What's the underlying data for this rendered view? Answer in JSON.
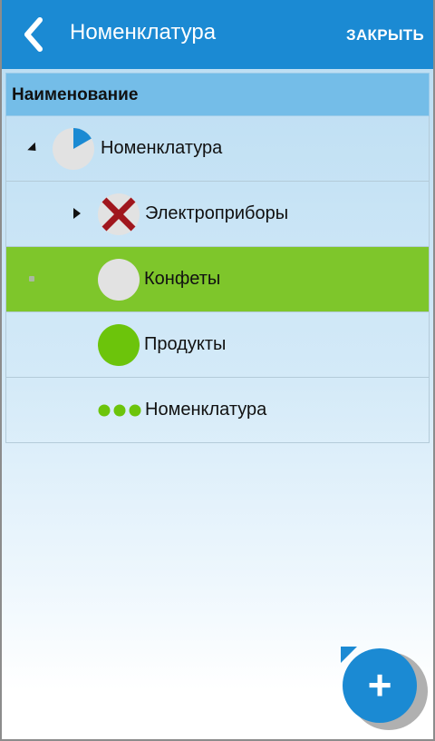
{
  "appbar": {
    "title": "Номенклатура",
    "close_label": "ЗАКРЫТЬ"
  },
  "grid": {
    "header": "Наименование",
    "rows": [
      {
        "label": "Номенклатура",
        "icon": "pie-chart-icon",
        "expander": "expanded",
        "selected": false
      },
      {
        "label": "Электроприборы",
        "icon": "red-x-circle-icon",
        "expander": "collapsed",
        "selected": false
      },
      {
        "label": "Конфеты",
        "icon": "gray-circle-icon",
        "expander": "leaf",
        "selected": true
      },
      {
        "label": "Продукты",
        "icon": "green-circle-icon",
        "expander": "none",
        "selected": false
      },
      {
        "label": "Номенклатура",
        "icon": "three-dots-icon",
        "expander": "none",
        "selected": false
      }
    ]
  },
  "fab": {
    "label": "+"
  },
  "colors": {
    "primary": "#1b8ad3",
    "selected_row": "#7ec62b",
    "header_row": "#74bde8",
    "green": "#6cc40b",
    "red_x": "#a0161d"
  }
}
